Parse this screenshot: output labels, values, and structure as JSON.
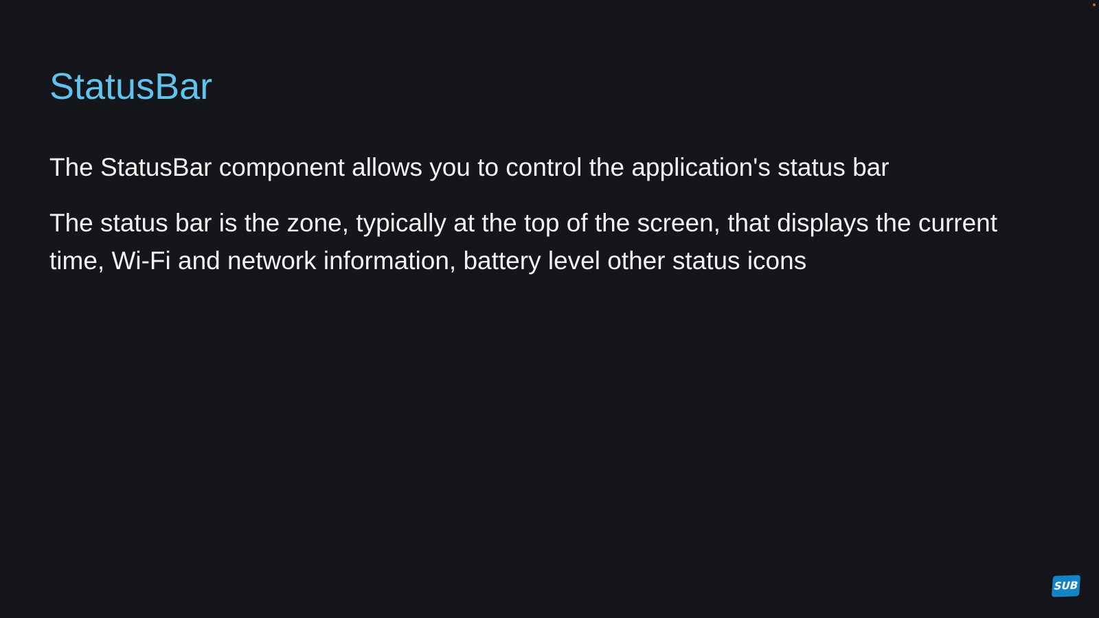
{
  "slide": {
    "title": "StatusBar",
    "paragraphs": [
      "The StatusBar component allows you to control the application's status bar",
      "The status bar is the zone, typically at the top of the screen, that displays the current time, Wi-Fi and network information, battery level other status icons"
    ]
  },
  "overlay": {
    "subscribe_badge_label": "SUB"
  },
  "colors": {
    "background": "#14161b",
    "title": "#61c3ec",
    "body_text": "#f2f2f2",
    "badge": "#1583c4"
  }
}
